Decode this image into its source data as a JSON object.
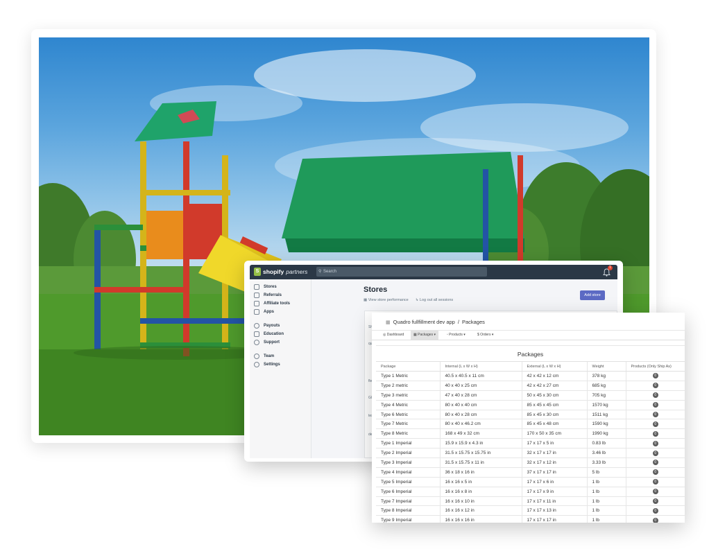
{
  "partners": {
    "logo_brand": "shopify",
    "logo_sub": "partners",
    "search_placeholder": "Search",
    "notification_count": "1",
    "nav": [
      {
        "label": "Stores",
        "icon": "store-icon"
      },
      {
        "label": "Referrals",
        "icon": "referrals-icon"
      },
      {
        "label": "Affiliate tools",
        "icon": "affiliate-tools-icon"
      },
      {
        "label": "Apps",
        "icon": "apps-icon"
      },
      {
        "label": "Payouts",
        "icon": "payouts-icon"
      },
      {
        "label": "Education",
        "icon": "education-icon"
      },
      {
        "label": "Support",
        "icon": "support-icon"
      },
      {
        "label": "Team",
        "icon": "team-icon"
      },
      {
        "label": "Settings",
        "icon": "settings-icon"
      }
    ],
    "page_title": "Stores",
    "view_performance": "View store performance",
    "log_out": "Log out all sessions",
    "add_store": "Add store",
    "row_labels": [
      "Sh",
      "qua",
      "flex",
      "Glit",
      "test",
      "dev"
    ]
  },
  "packages": {
    "app_path": "Quadro fullfillment dev app",
    "separator": "/",
    "current_page": "Packages",
    "tabs": [
      "Dashboard",
      "Packages",
      "Products",
      "Orders"
    ],
    "title": "Packages",
    "columns": [
      "Package",
      "Internal (L x W x H)",
      "External (L x W x H)",
      "Weight",
      "Products (Only Ship As)"
    ],
    "rows": [
      [
        "Type 1 Metric",
        "40.5 x 40.5 x 11 cm",
        "42 x 42 x 12 cm",
        "378 kg",
        "0"
      ],
      [
        "Type 2 metric",
        "40 x 40 x 25 cm",
        "42 x 42 x 27 cm",
        "685 kg",
        "0"
      ],
      [
        "Type 3 metric",
        "47 x 40 x 28 cm",
        "50 x 45 x 30 cm",
        "705 kg",
        "0"
      ],
      [
        "Type 4 Metric",
        "80 x 40 x 40 cm",
        "85 x 45 x 45 cm",
        "1570 kg",
        "0"
      ],
      [
        "Type 6 Metric",
        "80 x 40 x 28 cm",
        "85 x 45 x 30 cm",
        "1511 kg",
        "0"
      ],
      [
        "Type 7 Metric",
        "80 x 40 x 46.2 cm",
        "85 x 45 x 48 cm",
        "1590 kg",
        "0"
      ],
      [
        "Type 8 Metric",
        "168 x 49 x 32 cm",
        "170 x 50 x 35 cm",
        "1990 kg",
        "0"
      ],
      [
        "Type 1 Imperial",
        "15.9 x 15.9 x 4.3 in",
        "17 x 17 x 5 in",
        "0.83 lb",
        "0"
      ],
      [
        "Type 2 Imperial",
        "31.5 x 15.75 x 15.75 in",
        "32 x 17 x 17 in",
        "3.46 lb",
        "0"
      ],
      [
        "Type 3 Imperial",
        "31.5 x 15.75 x 11 in",
        "32 x 17 x 12 in",
        "3.33 lb",
        "0"
      ],
      [
        "Type 4 Imperial",
        "36 x 18 x 16 in",
        "37 x 17 x 17 in",
        "5 lb",
        "0"
      ],
      [
        "Type 5 Imperial",
        "16 x 16 x 5 in",
        "17 x 17 x 6 in",
        "1 lb",
        "0"
      ],
      [
        "Type 6 Imperial",
        "16 x 16 x 8 in",
        "17 x 17 x 9 in",
        "1 lb",
        "0"
      ],
      [
        "Type 7 Imperial",
        "16 x 16 x 10 in",
        "17 x 17 x 11 in",
        "1 lb",
        "0"
      ],
      [
        "Type 8 Imperial",
        "16 x 16 x 12 in",
        "17 x 17 x 13 in",
        "1 lb",
        "0"
      ],
      [
        "Type 9 Imperial",
        "16 x 16 x 16 in",
        "17 x 17 x 17 in",
        "1 lb",
        "0"
      ]
    ]
  },
  "colors": {
    "shopify_green": "#95bf47",
    "topbar": "#2b3846",
    "primary_button": "#5c6ac4",
    "notification": "#e3452f"
  }
}
